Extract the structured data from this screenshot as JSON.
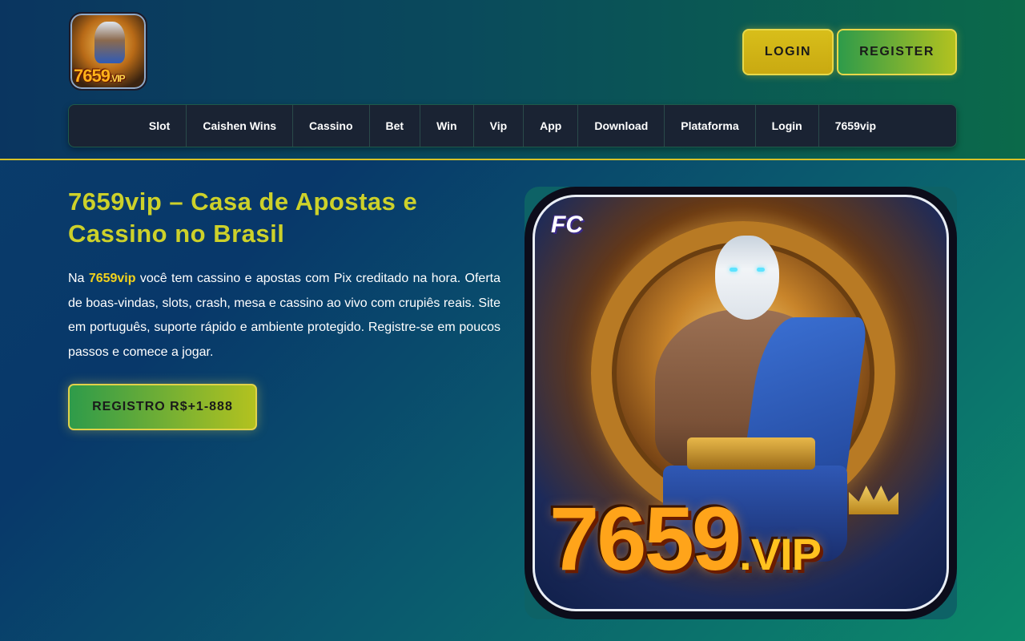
{
  "header": {
    "logo_text": "7659",
    "logo_suffix": ".VIP",
    "login_label": "LOGIN",
    "register_label": "REGISTER"
  },
  "nav": {
    "items": [
      {
        "label": "Slot"
      },
      {
        "label": "Caishen Wins"
      },
      {
        "label": "Cassino"
      },
      {
        "label": "Bet"
      },
      {
        "label": "Win"
      },
      {
        "label": "Vip"
      },
      {
        "label": "App"
      },
      {
        "label": "Download"
      },
      {
        "label": "Plataforma"
      },
      {
        "label": "Login"
      },
      {
        "label": "7659vip"
      }
    ]
  },
  "hero": {
    "title": "7659vip – Casa de Apostas e Cassino no Brasil",
    "text_prefix": "Na ",
    "brand": "7659vip",
    "text_rest": " você tem cassino e apostas com Pix creditado na hora. Oferta de boas-vindas, slots, crash, mesa e cassino ao vivo com crupiês reais. Site em português, suporte rápido e ambiente protegido. Registre-se em poucos passos e comece a jogar.",
    "cta_label": "REGISTRO R$+1-888",
    "image": {
      "badge": "FC",
      "brand_number": "7659",
      "brand_suffix": ".VIP"
    }
  },
  "colors": {
    "accent_yellow": "#cdd12a",
    "brand_highlight": "#f2d21c",
    "nav_background": "#1a2333",
    "header_divider": "#d8c227"
  }
}
